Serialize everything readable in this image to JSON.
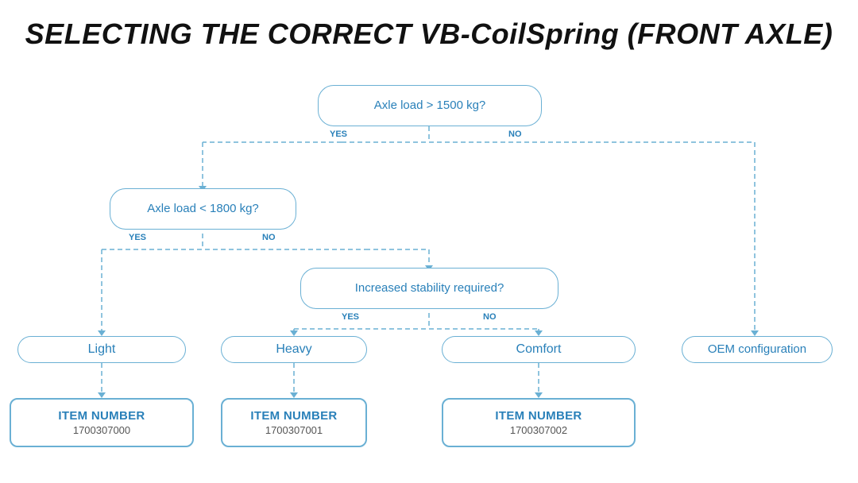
{
  "title": "SELECTING THE CORRECT VB-CoilSpring (FRONT AXLE)",
  "questions": [
    {
      "id": "q1",
      "text": "Axle load > 1500 kg?",
      "yes_label": "YES",
      "no_label": "NO"
    },
    {
      "id": "q2",
      "text": "Axle load < 1800 kg?",
      "yes_label": "YES",
      "no_label": "NO"
    },
    {
      "id": "q3",
      "text": "Increased stability required?",
      "yes_label": "YES",
      "no_label": "NO"
    }
  ],
  "results": [
    {
      "id": "r_light",
      "label": "Light"
    },
    {
      "id": "r_heavy",
      "label": "Heavy"
    },
    {
      "id": "r_comfort",
      "label": "Comfort"
    },
    {
      "id": "r_oem",
      "label": "OEM configuration"
    }
  ],
  "items": [
    {
      "id": "i1",
      "label": "ITEM NUMBER",
      "number": "1700307000"
    },
    {
      "id": "i2",
      "label": "ITEM NUMBER",
      "number": "1700307001"
    },
    {
      "id": "i3",
      "label": "ITEM NUMBER",
      "number": "1700307002"
    }
  ]
}
